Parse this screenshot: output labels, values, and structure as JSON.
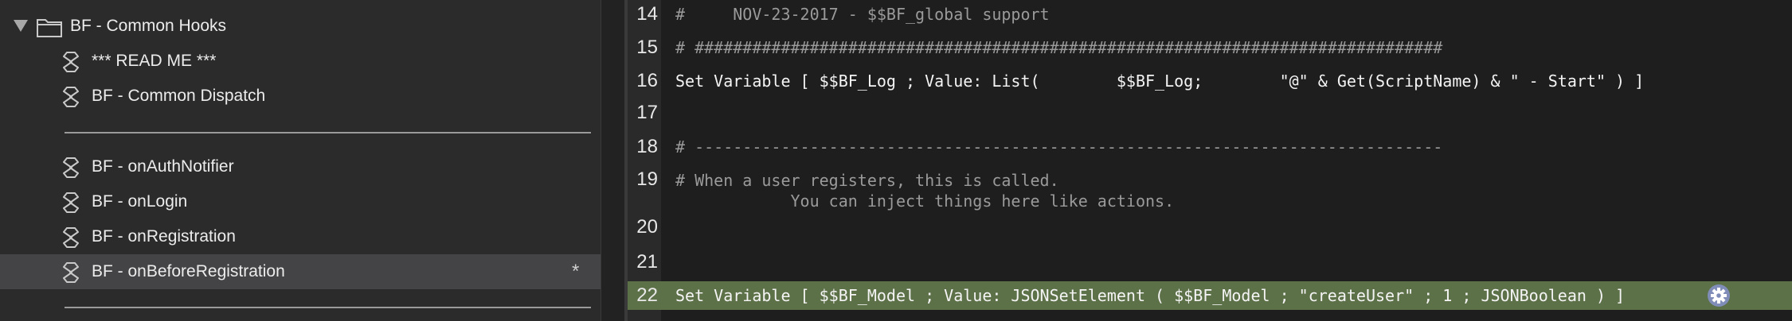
{
  "sidebar": {
    "folder": {
      "label": "BF - Common Hooks",
      "expanded": true
    },
    "items": [
      {
        "label": "*** READ ME ***",
        "type": "script"
      },
      {
        "label": "BF - Common Dispatch",
        "type": "script"
      },
      {
        "type": "separator"
      },
      {
        "label": "BF - onAuthNotifier",
        "type": "script"
      },
      {
        "label": "BF - onLogin",
        "type": "script"
      },
      {
        "label": "BF - onRegistration",
        "type": "script"
      },
      {
        "label": "BF - onBeforeRegistration",
        "type": "script",
        "selected": true,
        "modified_marker": "*"
      },
      {
        "type": "separator"
      }
    ]
  },
  "editor": {
    "lines": [
      {
        "no": "14",
        "text": "#     NOV-23-2017 - $$BF_global support",
        "kind": "comment"
      },
      {
        "no": "15",
        "text": "# ##############################################################################",
        "kind": "comment"
      },
      {
        "no": "16",
        "text": "Set Variable [ $$BF_Log ; Value: List(        $$BF_Log;        \"@\" & Get(ScriptName) & \" - Start\" ) ]",
        "kind": "step"
      },
      {
        "no": "17",
        "text": "",
        "kind": "blank"
      },
      {
        "no": "18",
        "text": "# ------------------------------------------------------------------------------",
        "kind": "comment"
      },
      {
        "no": "19",
        "text": "# When a user registers, this is called.\n            You can inject things here like actions.",
        "kind": "comment"
      },
      {
        "no": "20",
        "text": "",
        "kind": "blank"
      },
      {
        "no": "21",
        "text": "",
        "kind": "blank"
      },
      {
        "no": "22",
        "text": "Set Variable [ $$BF_Model ; Value: JSONSetElement ( $$BF_Model ; \"createUser\" ; 1 ; JSONBoolean ) ]",
        "kind": "step",
        "active": true,
        "gear_icon": "gear-icon"
      }
    ]
  },
  "colors": {
    "sidebar_bg": "#2b2b2b",
    "selected_row": "#444446",
    "editor_bg": "#1e1e1e",
    "active_line": "#5d7149",
    "comment": "#9a9a9a"
  }
}
